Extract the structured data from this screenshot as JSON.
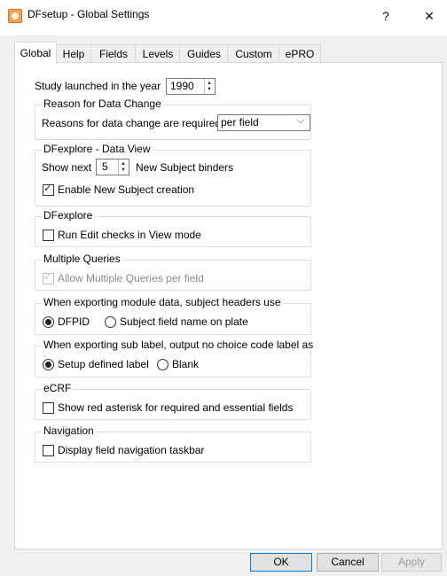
{
  "window": {
    "title": "DFsetup - Global Settings",
    "help_glyph": "?",
    "close_glyph": "✕"
  },
  "tabs": [
    {
      "label": "Global",
      "active": true
    },
    {
      "label": "Help"
    },
    {
      "label": "Fields"
    },
    {
      "label": "Levels"
    },
    {
      "label": "Guides"
    },
    {
      "label": "Custom"
    },
    {
      "label": "ePRO"
    }
  ],
  "global": {
    "study_launched_label": "Study launched in the year",
    "study_launched_value": "1990",
    "reason_group": {
      "title": "Reason for Data Change",
      "label": "Reasons for data change are required",
      "value": "per field"
    },
    "dfexplore_view_group": {
      "title": "DFexplore - Data View",
      "show_next_label": "Show next",
      "show_next_value": "5",
      "binders_label": "New Subject binders",
      "enable_label": "Enable New Subject creation",
      "enable_checked": true
    },
    "dfexplore_group": {
      "title": "DFexplore",
      "run_edit_label": "Run Edit checks in View mode",
      "run_edit_checked": false
    },
    "multiple_queries_group": {
      "title": "Multiple Queries",
      "allow_label": "Allow Multiple Queries per field",
      "allow_checked": true,
      "disabled": true
    },
    "export_headers_group": {
      "title": "When exporting module data, subject headers use",
      "option1": "DFPID",
      "option2": "Subject field name on plate",
      "selected": "DFPID"
    },
    "export_sublabel_group": {
      "title": "When exporting sub label, output no choice code label as",
      "option1": "Setup defined label",
      "option2": "Blank",
      "selected": "Setup defined label"
    },
    "ecrf_group": {
      "title": "eCRF",
      "asterisk_label": "Show red asterisk for required and essential fields",
      "asterisk_checked": false
    },
    "navigation_group": {
      "title": "Navigation",
      "taskbar_label": "Display field navigation taskbar",
      "taskbar_checked": false
    }
  },
  "buttons": {
    "ok": "OK",
    "cancel": "Cancel",
    "apply": "Apply"
  },
  "icons": {
    "app": "dfsetup-app-icon",
    "spin_up": "▲",
    "spin_down": "▼",
    "combo_chevron": "⌵"
  }
}
